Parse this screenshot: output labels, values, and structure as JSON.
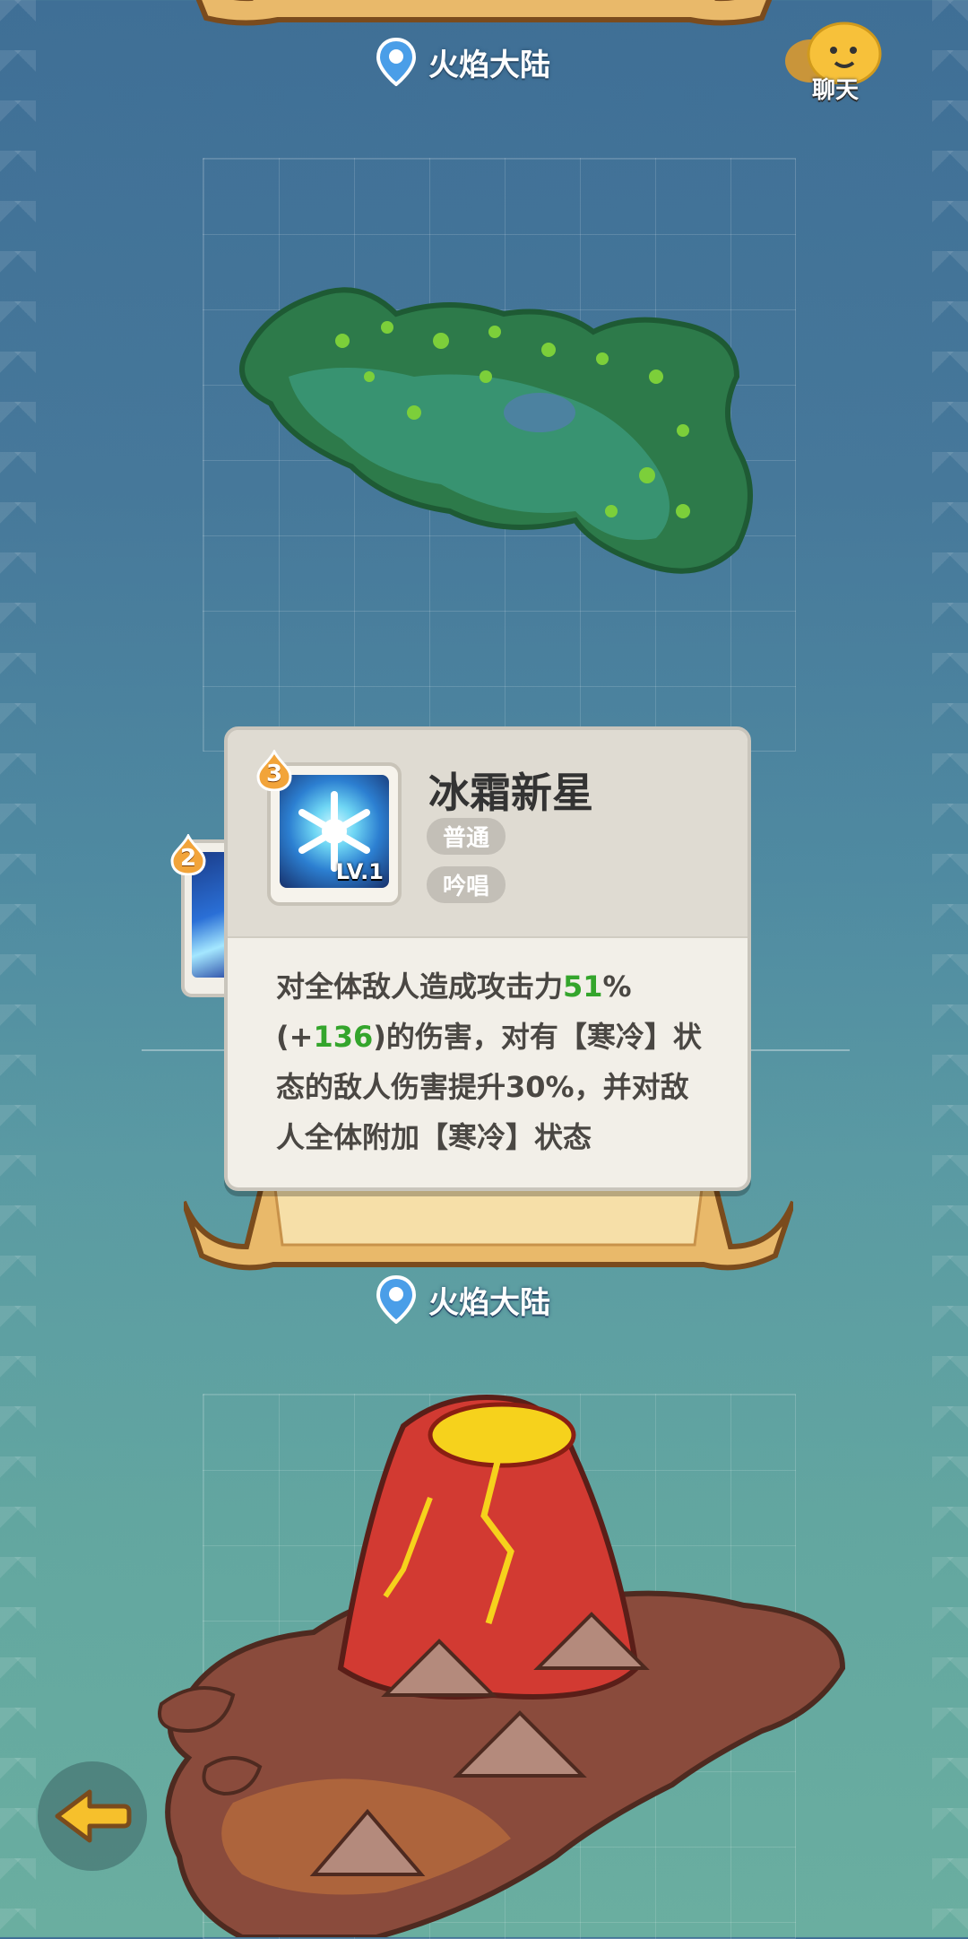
{
  "top": {
    "location": "火焰大陆",
    "chat_label": "聊天"
  },
  "skill_card": {
    "name": "冰霜新星",
    "level": "LV.1",
    "badge_number": "3",
    "tags": [
      "普通",
      "吟唱"
    ],
    "description_parts": {
      "p1": "对全体敌人造成攻击力",
      "hl1": "51",
      "p2": "%(+",
      "hl2": "136",
      "p3": ")的伤害，对有【寒冷】状态的敌人伤害提升30%，并对敌人全体附加【寒冷】状态"
    }
  },
  "peek_item": {
    "badge_number": "2"
  },
  "bottom": {
    "location": "火焰大陆"
  },
  "colors": {
    "highlight": "#34a52c",
    "banner": "#f3d9a0"
  }
}
